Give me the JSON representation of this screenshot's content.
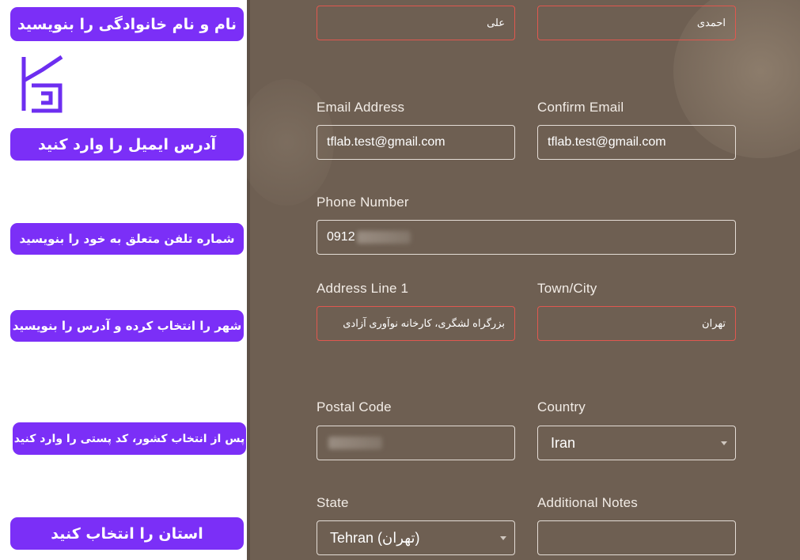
{
  "guide_labels": [
    "نام و نام خانوادگی را بنویسید",
    "آدرس ایمیل را وارد کنید",
    "شماره تلفن متعلق به خود را بنویسید",
    "شهر را انتخاب کرده و آدرس را بنویسید",
    "پس از انتخاب کشور، کد پستی را وارد کنید",
    "استان را انتخاب کنید"
  ],
  "logo": "tflab-logo",
  "form": {
    "first_name_value": "علی",
    "last_name_value": "احمدی",
    "email_label": "Email Address",
    "email_value": "tflab.test@gmail.com",
    "confirm_email_label": "Confirm Email",
    "confirm_email_value": "tflab.test@gmail.com",
    "phone_label": "Phone Number",
    "phone_value": "0912",
    "address_label": "Address Line 1",
    "address_value": "بزرگراه لشگری، کارخانه نوآوری آزادی",
    "city_label": "Town/City",
    "city_value": "تهران",
    "postal_label": "Postal Code",
    "country_label": "Country",
    "country_value": "Iran",
    "state_label": "State",
    "state_value": "Tehran (تهران)",
    "notes_label": "Additional Notes"
  },
  "colors": {
    "accent": "#7b2ff7",
    "form_background": "#6e5f52",
    "error_border": "#e0584f"
  }
}
